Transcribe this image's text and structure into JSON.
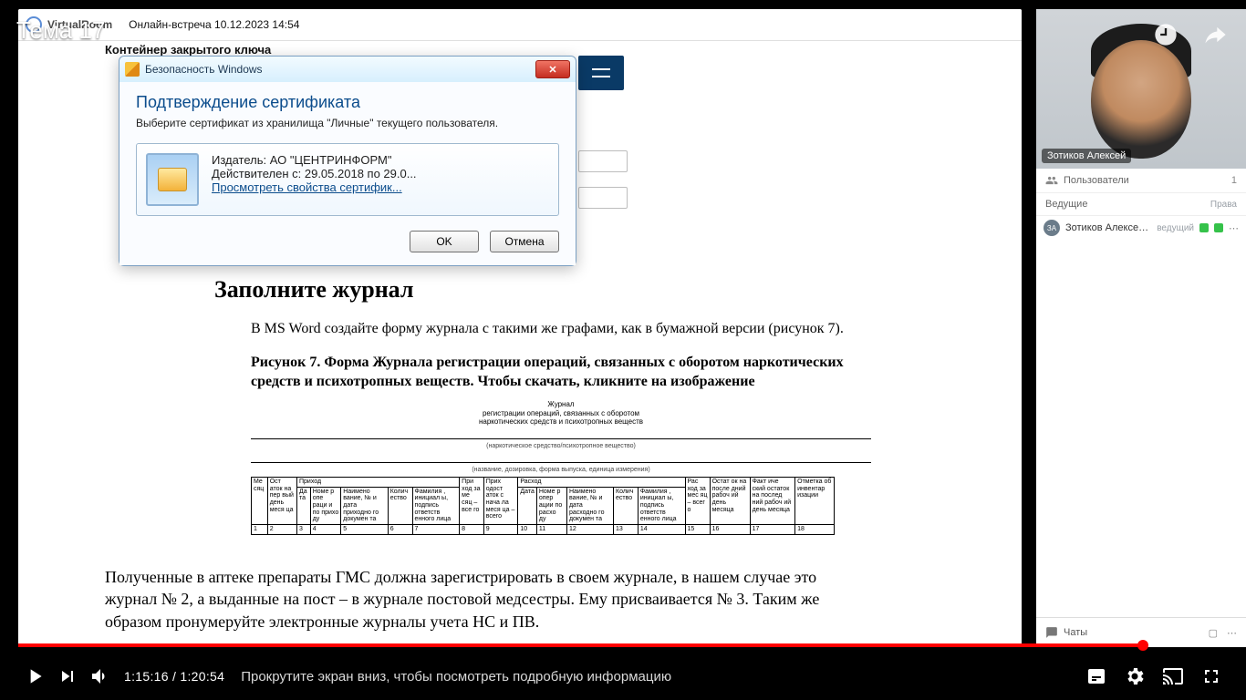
{
  "topic": "Тема 17",
  "virtualroom": {
    "app": "VirtualRoom",
    "meeting": "Онлайн-встреча 10.12.2023 14:54"
  },
  "doc": {
    "section_heading": "Контейнер закрытого ключа",
    "dialog": {
      "title": "Безопасность Windows",
      "heading": "Подтверждение сертификата",
      "sub": "Выберите сертификат из хранилища \"Личные\" текущего пользователя.",
      "issuer": "Издатель: АО \"ЦЕНТРИНФОРМ\"",
      "valid": "Действителен с: 29.05.2018 по 29.0...",
      "link": "Просмотреть свойства сертифик...",
      "ok": "OK",
      "cancel": "Отмена"
    },
    "title2": "Заполните журнал",
    "p1": "В MS Word создайте форму журнала с такими же графами, как в бумажной версии (рисунок 7).",
    "fig_caption": "Рисунок 7. Форма Журнала регистрации операций, связанных с оборотом наркотических средств и психотропных веществ. Чтобы скачать, кликните на изображение",
    "journal": {
      "t1": "Журнал",
      "t2": "регистрации операций, связанных с оборотом",
      "t3": "наркотических средств и психотропных веществ",
      "c1": "(наркотическое средство/психотропное вещество)",
      "c2": "(название, дозировка, форма выпуска, единица измерения)",
      "group_income": "Приход",
      "group_expense": "Расход",
      "cols": [
        "Ме сяц",
        "Ост аток на пер вый день меся ца",
        "Да та",
        "Номе р опе раци и по прихо ду",
        "Наимено вание, № и дата приходно го докумен та",
        "Колич ество",
        "Фамилия , инициал ы, подпись ответств енного лица",
        "При ход за ме сяц – все го",
        "Прих одост аток с нача ла меся ца – всего",
        "Дата",
        "Номе р опер ации по расхо ду",
        "Наимено вание, № и дата расходно го докумен та",
        "Колич ество",
        "Фамилия , инициал ы, подпись ответств енного лица",
        "Рас ход за мес яц – всег о",
        "Остат ок на после дний рабоч ий день месяца",
        "Факт иче ский остаток на послед ний рабоч ий день месяца",
        "Отметка об инвентар изации"
      ],
      "nums": [
        "1",
        "2",
        "3",
        "4",
        "5",
        "6",
        "7",
        "8",
        "9",
        "10",
        "11",
        "12",
        "13",
        "14",
        "15",
        "16",
        "17",
        "18"
      ]
    },
    "p2": "Полученные в аптеке препараты ГМС должна зарегистрировать в своем журнале, в нашем случае это журнал № 2, а выданные на пост – в журнале постовой медсестры. Ему присваивается № 3. Таким же образом пронумеруйте электронные журналы учета НС и ПВ."
  },
  "rightpanel": {
    "cam_name": "Зотиков Алексей",
    "users_label": "Пользователи",
    "users_count": "1",
    "hosts_label": "Ведущие",
    "rights_label": "Права",
    "user": {
      "initials": "ЗА",
      "name": "Зотиков Алексей Георги...",
      "role": "ведущий"
    },
    "chat_label": "Чаты"
  },
  "player": {
    "time_current": "1:15:16",
    "time_total": "1:20:54",
    "hint": "Прокрутите экран вниз, чтобы посмотреть подробную информацию",
    "played_pct": 93
  },
  "overlay": {
    "watchlater": "watch-later",
    "share": "share"
  }
}
